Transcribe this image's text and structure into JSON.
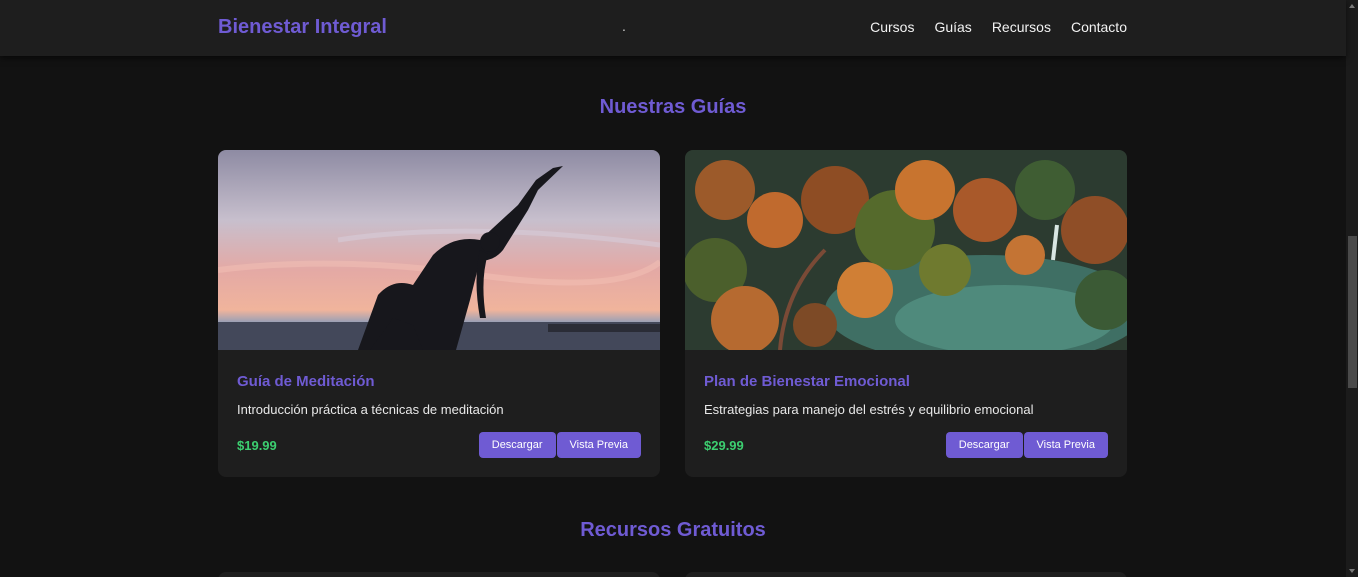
{
  "nav": {
    "brand": "Bienestar Integral",
    "dot": ".",
    "links": [
      "Cursos",
      "Guías",
      "Recursos",
      "Contacto"
    ]
  },
  "sections": {
    "guides_title": "Nuestras Guías",
    "resources_title": "Recursos Gratuitos"
  },
  "cards": [
    {
      "image": "yoga-silhouette-sunset",
      "title": "Guía de Meditación",
      "description": "Introducción práctica a técnicas de meditación",
      "price": "$19.99",
      "primary_label": "Descargar",
      "secondary_label": "Vista Previa"
    },
    {
      "image": "aerial-autumn-forest",
      "title": "Plan de Bienestar Emocional",
      "description": "Estrategias para manejo del estrés y equilibrio emocional",
      "price": "$29.99",
      "primary_label": "Descargar",
      "secondary_label": "Vista Previa"
    }
  ],
  "colors": {
    "accent": "#6f5bd3",
    "price": "#3ccf70",
    "background": "#121212",
    "surface": "#1e1e1e"
  }
}
